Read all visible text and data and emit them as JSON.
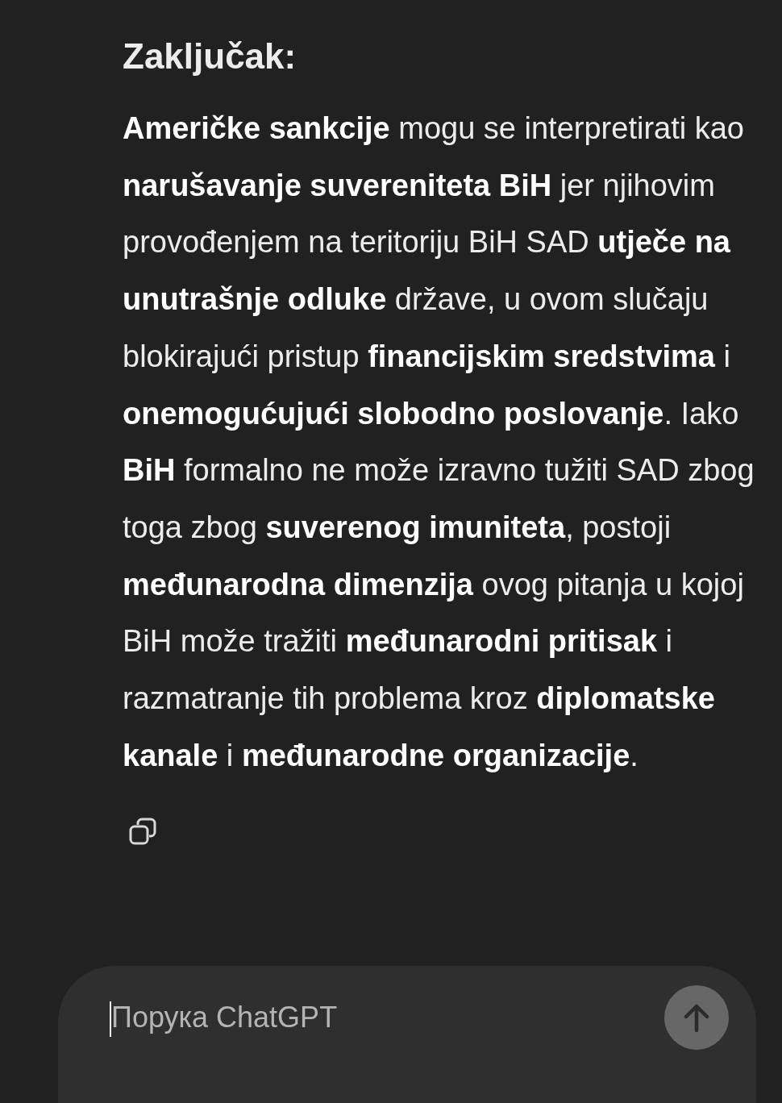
{
  "heading": "Zaključak:",
  "paragraph": "**Američke sankcije** mogu se interpretirati kao **narušavanje suvereniteta BiH** jer njihovim provođenjem na teritoriju BiH SAD **utječe na unutrašnje odluke** države, u ovom slučaju blokirajući pristup **financijskim sredstvima** i **onemogućujući slobodno poslovanje**. Iako **BiH** formalno ne može izravno tužiti SAD zbog toga zbog **suverenog imuniteta**, postoji **međunarodna dimenzija** ovog pitanja u kojoj BiH može tražiti **međunarodni pritisak** i razmatranje tih problema kroz **diplomatske kanale** i **međunarodne organizacije**.",
  "composer": {
    "placeholder": "Порука ChatGPT",
    "send_disabled": true
  }
}
